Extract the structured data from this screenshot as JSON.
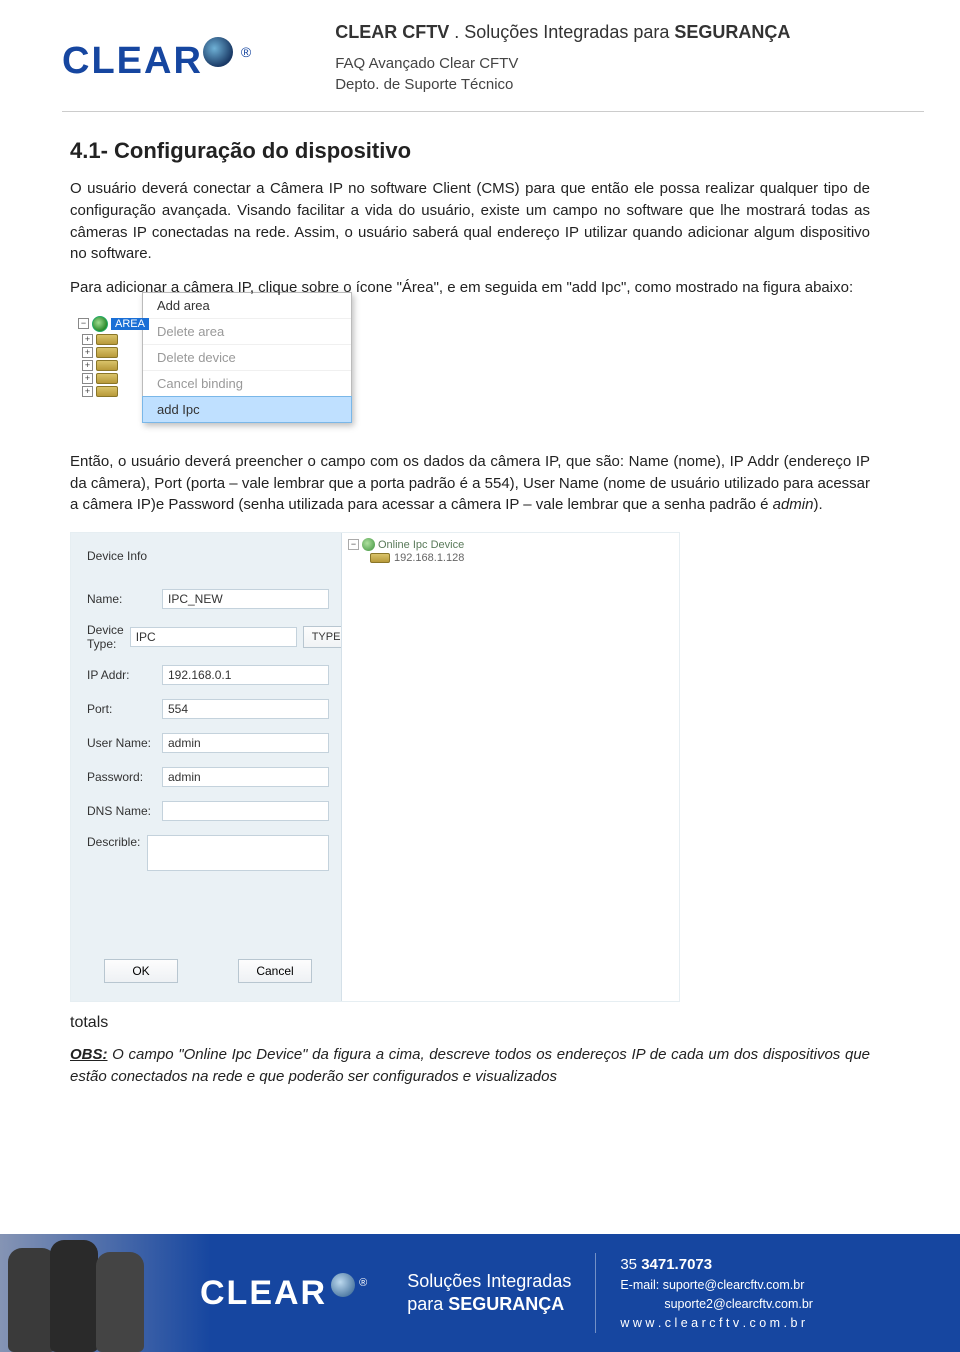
{
  "header": {
    "logo_text": "CLEAR",
    "logo_reg": "®",
    "brand_line_bold1": "CLEAR CFTV",
    "brand_line_mid": " . Soluções Integradas para ",
    "brand_line_bold2": "SEGURANÇA",
    "sub_line1": "FAQ Avançado Clear CFTV",
    "sub_line2": "Depto. de Suporte Técnico"
  },
  "section": {
    "title": "4.1- Configuração do dispositivo",
    "p1": "O usuário deverá conectar a Câmera IP no software Client (CMS) para que então ele possa realizar qualquer tipo de configuração avançada. Visando facilitar a vida do usuário, existe um campo no software que lhe mostrará todas as câmeras IP conectadas na rede. Assim, o usuário saberá qual endereço IP utilizar quando adicionar algum dispositivo no software.",
    "p2": "Para adicionar a câmera IP, clique sobre o ícone \"Área\", e em seguida em \"add Ipc\", como mostrado na figura abaixo:"
  },
  "tree": {
    "root": "AREA",
    "menu": [
      {
        "label": "Add area",
        "state": "normal"
      },
      {
        "label": "Delete area",
        "state": "disabled"
      },
      {
        "label": "Delete device",
        "state": "disabled"
      },
      {
        "label": "Cancel binding",
        "state": "disabled"
      },
      {
        "label": "add Ipc",
        "state": "selected"
      }
    ]
  },
  "middle": {
    "p3": "Então, o usuário deverá preencher o campo com os dados da câmera IP, que são: Name (nome), IP Addr (endereço IP da câmera), Port (porta – vale lembrar que a porta padrão é a 554), User Name (nome de usuário utilizado para acessar a câmera IP)e Password (senha utilizada para acessar a câmera IP – vale lembrar que a senha padrão é ",
    "p3_ital": "admin",
    "p3_end": ")."
  },
  "dialog": {
    "title": "Device Info",
    "fields": {
      "name_label": "Name:",
      "name_value": "IPC_NEW",
      "type_label": "Device Type:",
      "type_value": "IPC",
      "type_btn": "TYPE",
      "ip_label": "IP Addr:",
      "ip_value": "192.168.0.1",
      "port_label": "Port:",
      "port_value": "554",
      "user_label": "User Name:",
      "user_value": "admin",
      "pass_label": "Password:",
      "pass_value": "admin",
      "dns_label": "DNS Name:",
      "dns_value": "",
      "desc_label": "Describle:",
      "desc_value": ""
    },
    "ok": "OK",
    "cancel": "Cancel",
    "tree_title": "Online Ipc Device",
    "tree_ip": "192.168.1.128"
  },
  "obs": {
    "lead": "OBS:",
    "text": " O campo \"Online Ipc Device\" da figura a cima, descreve todos os endereços IP de cada um dos dispositivos que estão conectados na rede e que poderão ser configurados e visualizados"
  },
  "footer": {
    "logo": "CLEAR",
    "logo_reg": "®",
    "slogan1": "Soluções Integradas",
    "slogan2a": "para ",
    "slogan2b": "SEGURANÇA",
    "phone_pre": "35 ",
    "phone_bold": "3471.7073",
    "email_lbl": "E-mail: ",
    "email1": "suporte@clearcftv.com.br",
    "email2": "suporte2@clearcftv.com.br",
    "site_pre": "w w w . ",
    "site_bold": "c l e a r c f t v",
    "site_post": " . c o m . b r"
  }
}
